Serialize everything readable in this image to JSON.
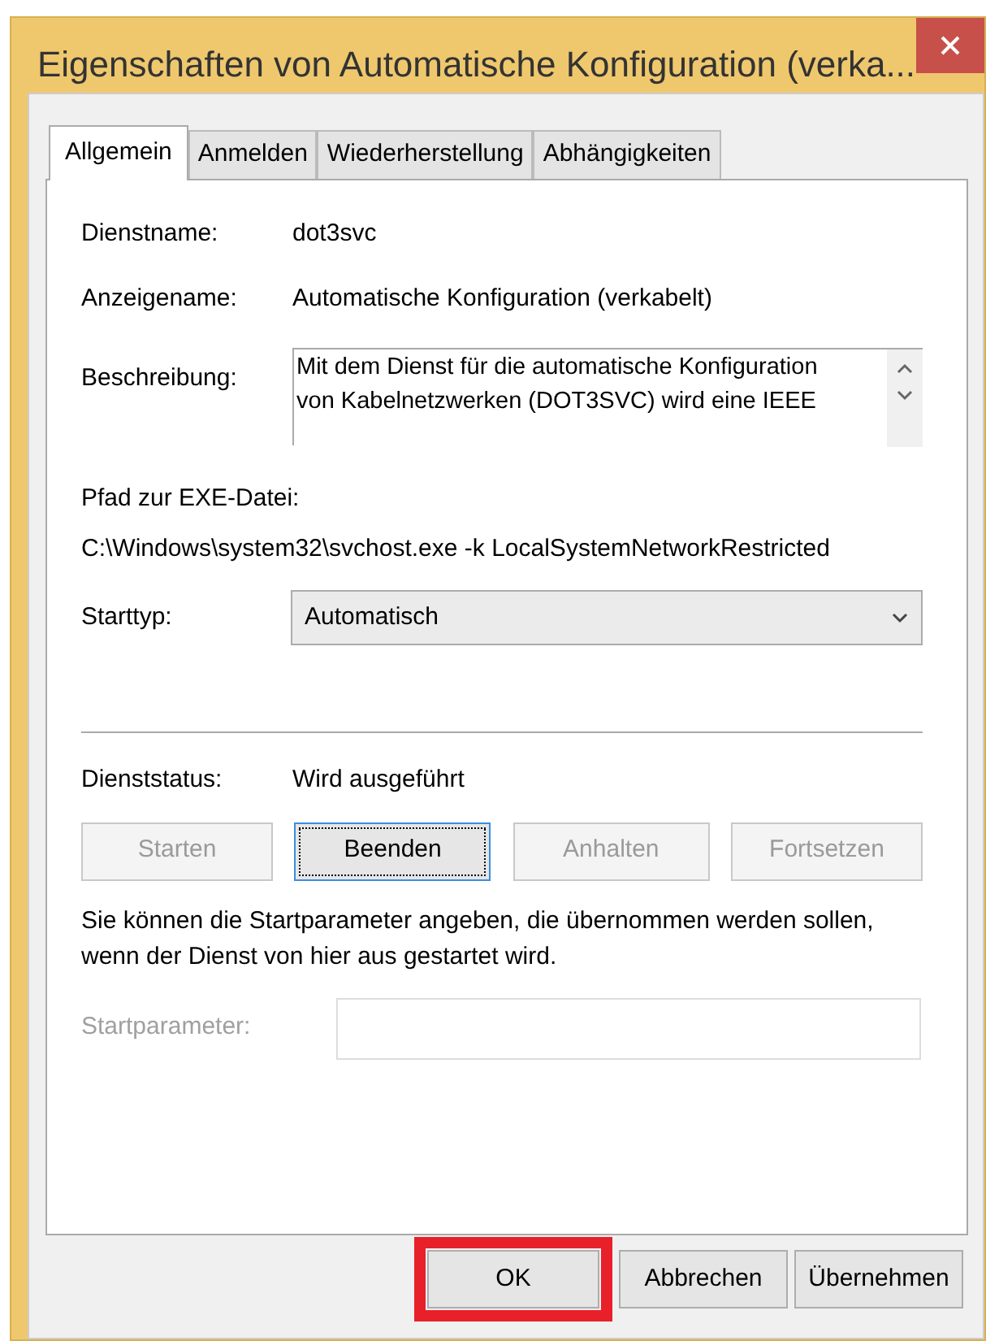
{
  "window": {
    "title": "Eigenschaften von Automatische Konfiguration (verka..."
  },
  "tabs": [
    {
      "label": "Allgemein",
      "selected": true
    },
    {
      "label": "Anmelden",
      "selected": false
    },
    {
      "label": "Wiederherstellung",
      "selected": false
    },
    {
      "label": "Abhängigkeiten",
      "selected": false
    }
  ],
  "info": [
    {
      "label": "Dienstname:",
      "value": "dot3svc"
    },
    {
      "label": "Anzeigename:",
      "value": "Automatische Konfiguration (verkabelt)"
    }
  ],
  "description": {
    "label": "Beschreibung:",
    "lines": [
      "Mit dem Dienst für die automatische Konfiguration",
      "von Kabelnetzwerken (DOT3SVC) wird eine IEEE"
    ]
  },
  "exe_path": {
    "label": "Pfad zur EXE-Datei:",
    "value": "C:\\Windows\\system32\\svchost.exe -k LocalSystemNetworkRestricted"
  },
  "startup_type": {
    "label": "Starttyp:",
    "value": "Automatisch"
  },
  "service_status": {
    "label": "Dienststatus:",
    "value": "Wird ausgeführt"
  },
  "service_buttons": [
    {
      "label": "Starten",
      "disabled": true,
      "focused": false
    },
    {
      "label": "Beenden",
      "disabled": false,
      "focused": true
    },
    {
      "label": "Anhalten",
      "disabled": true,
      "focused": false
    },
    {
      "label": "Fortsetzen",
      "disabled": true,
      "focused": false
    }
  ],
  "hint": "Sie können die Startparameter angeben, die übernommen werden sollen, wenn der Dienst von hier aus gestartet wird.",
  "start_parameters": {
    "label": "Startparameter:",
    "disabled": true
  },
  "dialog_buttons": [
    {
      "label": "OK",
      "highlighted": true
    },
    {
      "label": "Abbrechen",
      "highlighted": false
    },
    {
      "label": "Übernehmen",
      "highlighted": false
    }
  ]
}
